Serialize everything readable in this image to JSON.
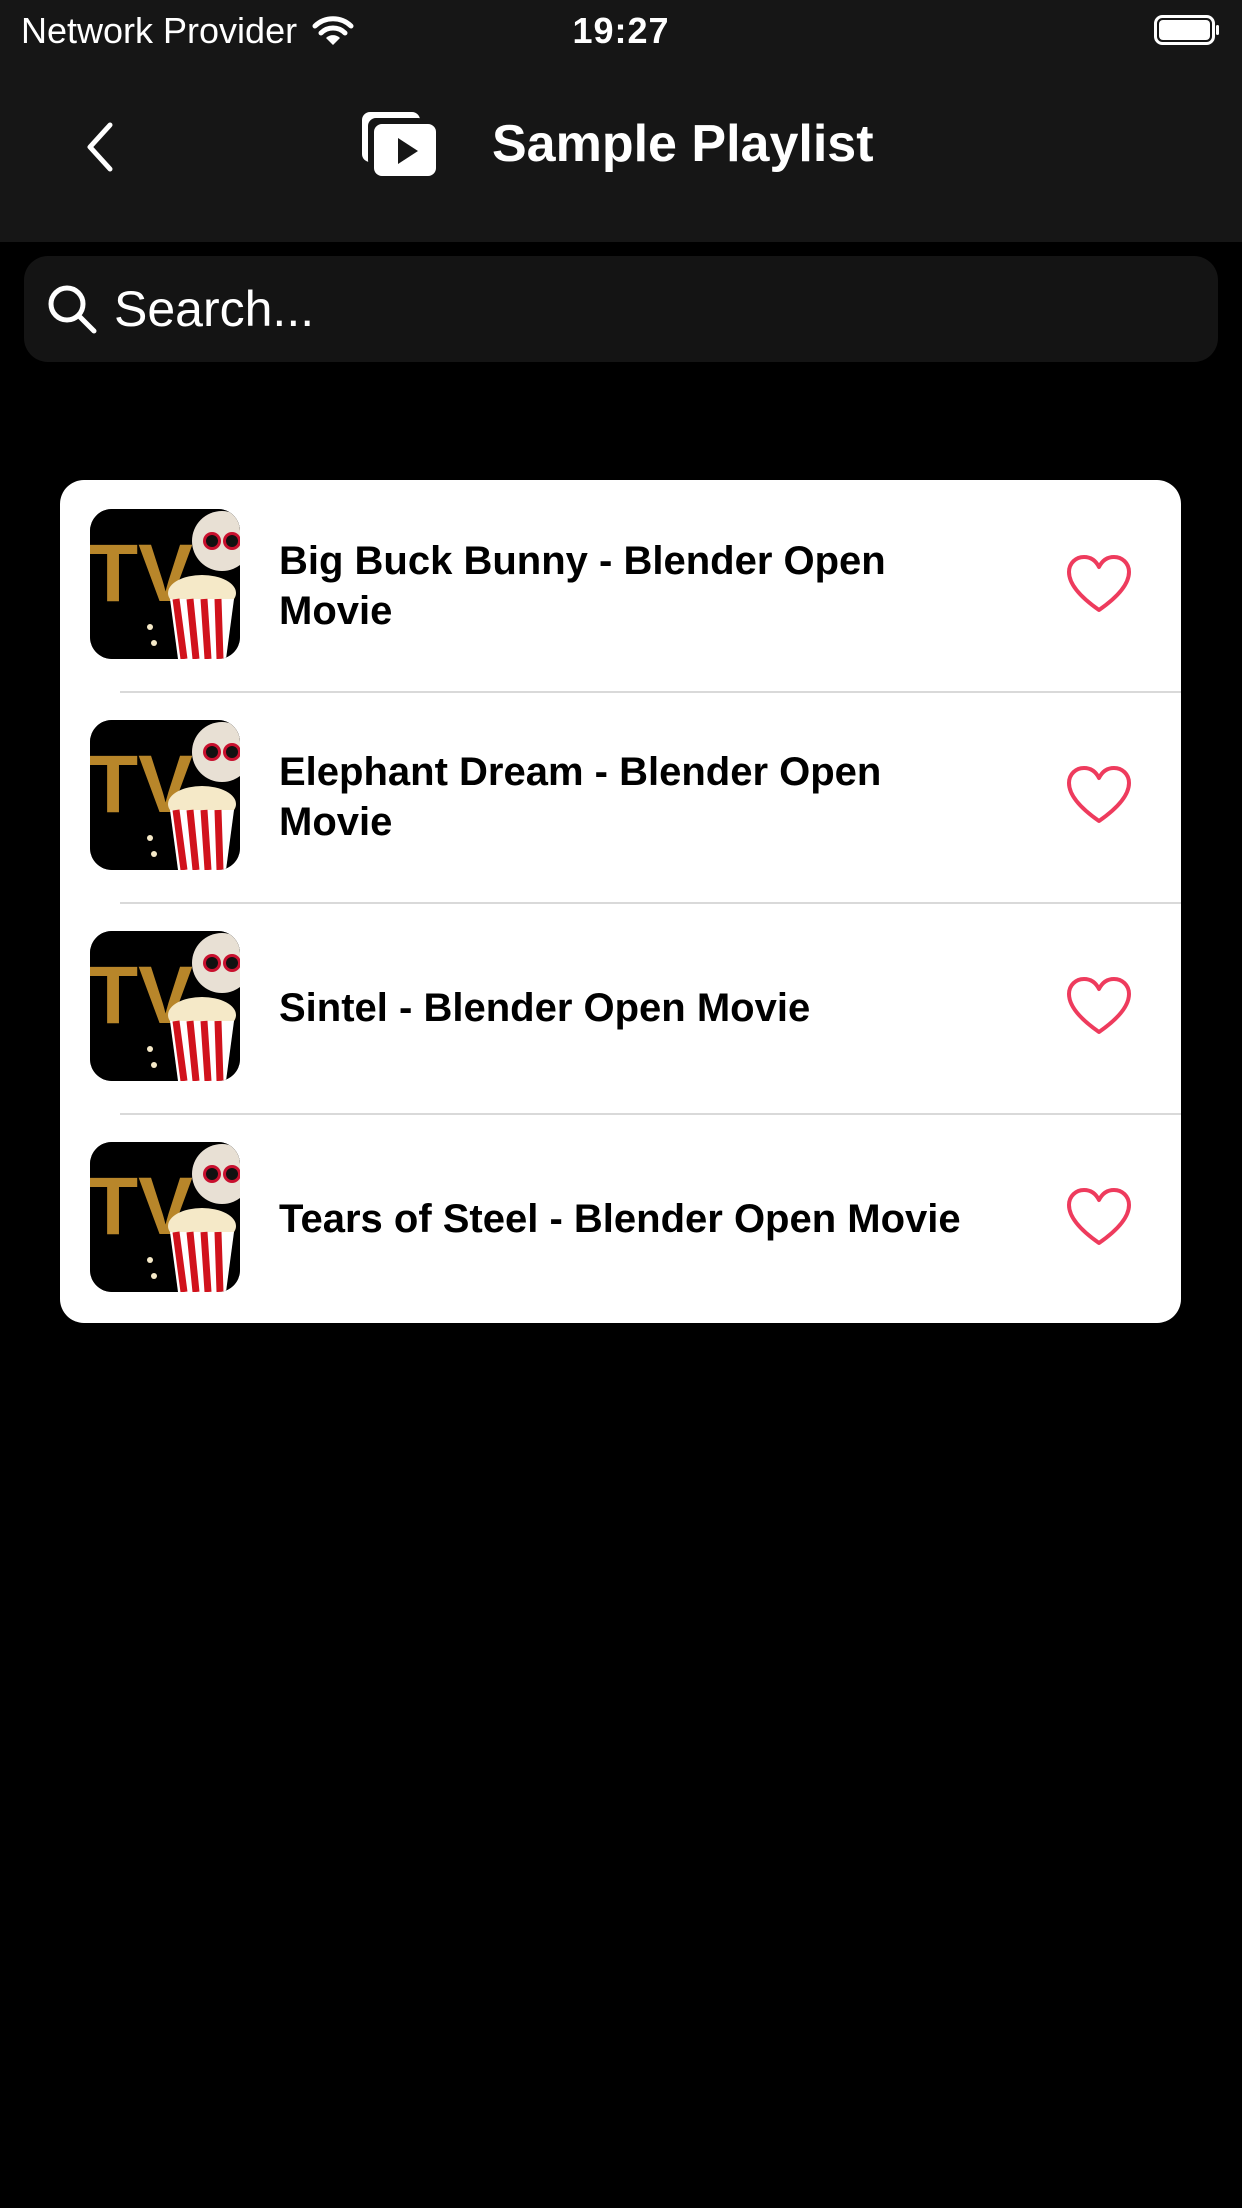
{
  "status_bar": {
    "carrier": "Network Provider",
    "time": "19:27",
    "wifi_icon": "wifi-icon",
    "battery_icon": "battery-icon"
  },
  "nav": {
    "back_icon": "chevron-left-icon",
    "title_icon": "playlist-play-icon",
    "title": "Sample Playlist"
  },
  "search": {
    "placeholder": "Search...",
    "value": "",
    "icon": "search-icon"
  },
  "playlist": {
    "items": [
      {
        "title": "Big Buck Bunny - Blender Open Movie",
        "thumbnail": "tv-popcorn-dog-thumbnail",
        "favorite": false
      },
      {
        "title": "Elephant Dream - Blender Open Movie",
        "thumbnail": "tv-popcorn-dog-thumbnail",
        "favorite": false
      },
      {
        "title": "Sintel - Blender Open Movie",
        "thumbnail": "tv-popcorn-dog-thumbnail",
        "favorite": false
      },
      {
        "title": "Tears of Steel - Blender Open Movie",
        "thumbnail": "tv-popcorn-dog-thumbnail",
        "favorite": false
      }
    ]
  },
  "colors": {
    "background": "#000000",
    "bar": "#161616",
    "search_bg": "#141414",
    "heart": "#ee3b5d",
    "thumb_text": "#b8862a"
  }
}
